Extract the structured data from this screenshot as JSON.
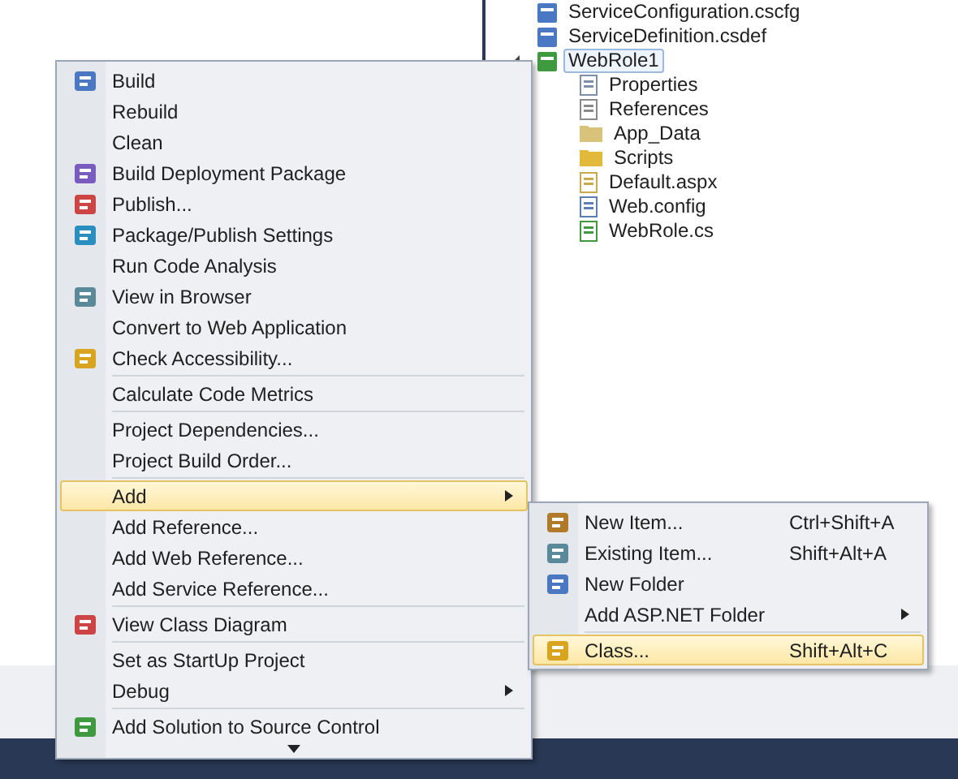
{
  "solution_explorer": {
    "items": [
      {
        "label": "ServiceConfiguration.cscfg",
        "selected": false,
        "expanded": false
      },
      {
        "label": "ServiceDefinition.csdef",
        "selected": false,
        "expanded": false
      },
      {
        "label": "WebRole1",
        "selected": true,
        "expanded": true,
        "children": [
          {
            "label": "Properties"
          },
          {
            "label": "References"
          },
          {
            "label": "App_Data"
          },
          {
            "label": "Scripts"
          },
          {
            "label": "Default.aspx"
          },
          {
            "label": "Web.config"
          },
          {
            "label": "WebRole.cs"
          }
        ]
      }
    ]
  },
  "context_menu": {
    "groups": [
      [
        {
          "label": "Build",
          "icon": true,
          "selected": false,
          "submenu": false
        },
        {
          "label": "Rebuild",
          "icon": false,
          "selected": false,
          "submenu": false
        },
        {
          "label": "Clean",
          "icon": false,
          "selected": false,
          "submenu": false
        },
        {
          "label": "Build Deployment Package",
          "icon": true,
          "selected": false,
          "submenu": false
        },
        {
          "label": "Publish...",
          "icon": true,
          "selected": false,
          "submenu": false
        },
        {
          "label": "Package/Publish Settings",
          "icon": true,
          "selected": false,
          "submenu": false
        },
        {
          "label": "Run Code Analysis",
          "icon": false,
          "selected": false,
          "submenu": false
        },
        {
          "label": "View in Browser",
          "icon": true,
          "selected": false,
          "submenu": false
        },
        {
          "label": "Convert to Web Application",
          "icon": false,
          "selected": false,
          "submenu": false
        },
        {
          "label": "Check Accessibility...",
          "icon": true,
          "selected": false,
          "submenu": false
        }
      ],
      [
        {
          "label": "Calculate Code Metrics",
          "icon": false,
          "selected": false,
          "submenu": false
        }
      ],
      [
        {
          "label": "Project Dependencies...",
          "icon": false,
          "selected": false,
          "submenu": false
        },
        {
          "label": "Project Build Order...",
          "icon": false,
          "selected": false,
          "submenu": false
        }
      ],
      [
        {
          "label": "Add",
          "icon": false,
          "selected": true,
          "submenu": true
        },
        {
          "label": "Add Reference...",
          "icon": false,
          "selected": false,
          "submenu": false
        },
        {
          "label": "Add Web Reference...",
          "icon": false,
          "selected": false,
          "submenu": false
        },
        {
          "label": "Add Service Reference...",
          "icon": false,
          "selected": false,
          "submenu": false
        }
      ],
      [
        {
          "label": "View Class Diagram",
          "icon": true,
          "selected": false,
          "submenu": false
        }
      ],
      [
        {
          "label": "Set as StartUp Project",
          "icon": false,
          "selected": false,
          "submenu": false
        },
        {
          "label": "Debug",
          "icon": false,
          "selected": false,
          "submenu": true
        }
      ],
      [
        {
          "label": "Add Solution to Source Control",
          "icon": true,
          "selected": false,
          "submenu": false
        }
      ]
    ]
  },
  "add_submenu": {
    "groups": [
      [
        {
          "label": "New Item...",
          "shortcut": "Ctrl+Shift+A",
          "icon": true,
          "selected": false,
          "submenu": false
        },
        {
          "label": "Existing Item...",
          "shortcut": "Shift+Alt+A",
          "icon": true,
          "selected": false,
          "submenu": false
        },
        {
          "label": "New Folder",
          "icon": true,
          "selected": false,
          "submenu": false
        },
        {
          "label": "Add ASP.NET Folder",
          "icon": false,
          "selected": false,
          "submenu": true
        }
      ],
      [
        {
          "label": "Class...",
          "shortcut": "Shift+Alt+C",
          "icon": true,
          "selected": true,
          "submenu": false
        }
      ]
    ]
  }
}
